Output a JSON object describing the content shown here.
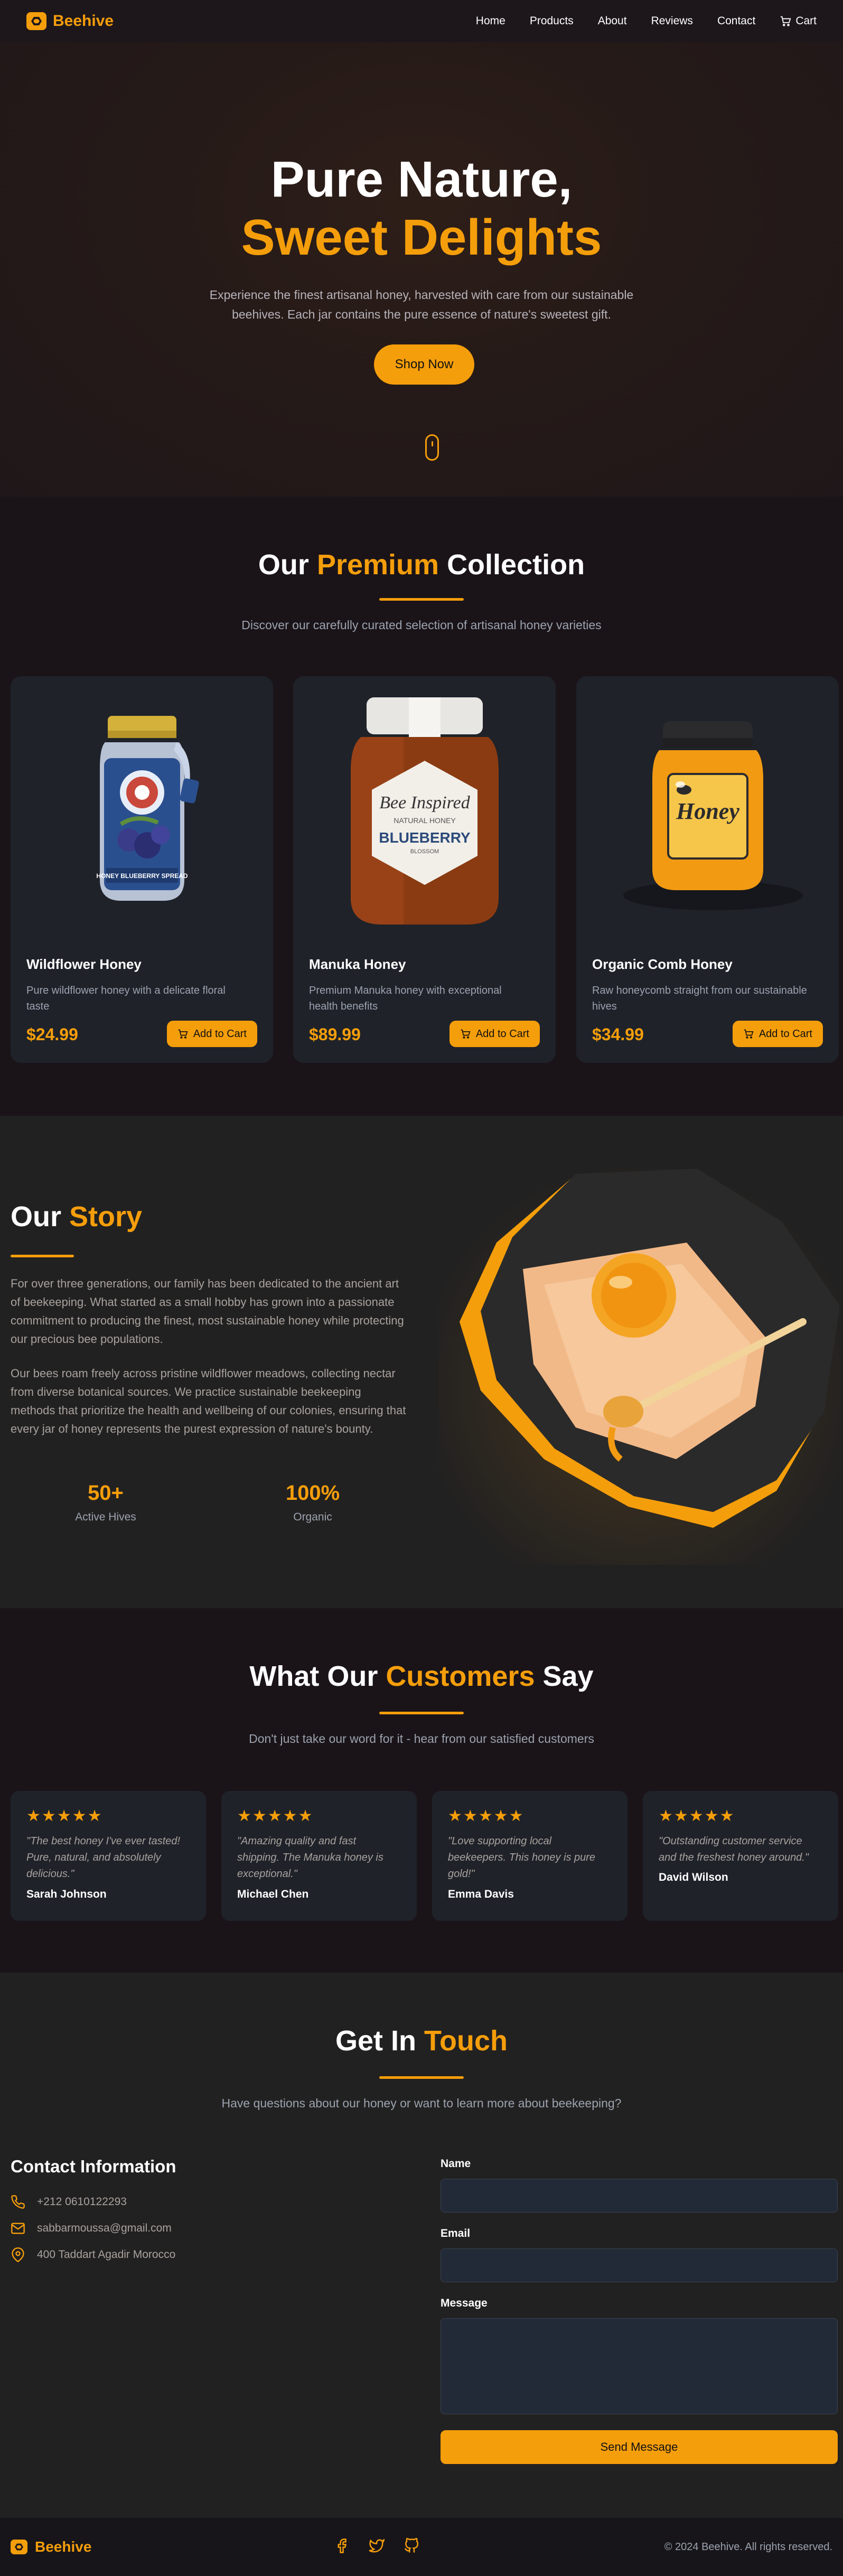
{
  "colors": {
    "accent": "#f59e0b",
    "background": "#1a1419",
    "card": "#1f2229",
    "section_alt": "#222121"
  },
  "nav": {
    "brand": "Beehive",
    "links": [
      "Home",
      "Products",
      "About",
      "Reviews",
      "Contact"
    ],
    "cart": "Cart"
  },
  "hero": {
    "title_line1": "Pure Nature,",
    "title_line2": "Sweet Delights",
    "subtitle": "Experience the finest artisanal honey, harvested with care from our sustainable beehives. Each jar contains the pure essence of nature's sweetest gift.",
    "cta": "Shop Now"
  },
  "products": {
    "title_pre": "Our",
    "title_accent": "Premium",
    "title_post": "Collection",
    "subtitle": "Discover our carefully curated selection of artisanal honey varieties",
    "add_label": "Add to Cart",
    "items": [
      {
        "name": "Wildflower Honey",
        "desc": "Pure wildflower honey with a delicate floral taste",
        "price": "$24.99",
        "jar_label": "HONEY BLUEBERRY SPREAD"
      },
      {
        "name": "Manuka Honey",
        "desc": "Premium Manuka honey with exceptional health benefits",
        "price": "$89.99",
        "jar_label_1": "Bee Inspired",
        "jar_label_2": "NATURAL HONEY",
        "jar_label_3": "BLUEBERRY",
        "jar_label_4": "BLOSSOM"
      },
      {
        "name": "Organic Comb Honey",
        "desc": "Raw honeycomb straight from our sustainable hives",
        "price": "$34.99",
        "jar_label": "Honey"
      }
    ]
  },
  "story": {
    "title_pre": "Our",
    "title_accent": "Story",
    "p1": "For over three generations, our family has been dedicated to the ancient art of beekeeping. What started as a small hobby has grown into a passionate commitment to producing the finest, most sustainable honey while protecting our precious bee populations.",
    "p2": "Our bees roam freely across pristine wildflower meadows, collecting nectar from diverse botanical sources. We practice sustainable beekeeping methods that prioritize the health and wellbeing of our colonies, ensuring that every jar of honey represents the purest expression of nature's bounty.",
    "stats": [
      {
        "value": "50+",
        "label": "Active Hives"
      },
      {
        "value": "100%",
        "label": "Organic"
      }
    ]
  },
  "reviews": {
    "title_pre": "What Our",
    "title_accent": "Customers",
    "title_post": "Say",
    "subtitle": "Don't just take our word for it - hear from our satisfied customers",
    "stars": "★★★★★",
    "items": [
      {
        "text": "\"The best honey I've ever tasted! Pure, natural, and absolutely delicious.\"",
        "name": "Sarah Johnson",
        "rating": 5
      },
      {
        "text": "\"Amazing quality and fast shipping. The Manuka honey is exceptional.\"",
        "name": "Michael Chen",
        "rating": 5
      },
      {
        "text": "\"Love supporting local beekeepers. This honey is pure gold!\"",
        "name": "Emma Davis",
        "rating": 5
      },
      {
        "text": "\"Outstanding customer service and the freshest honey around.\"",
        "name": "David Wilson",
        "rating": 5
      }
    ]
  },
  "contact": {
    "title_pre": "Get In",
    "title_accent": "Touch",
    "subtitle": "Have questions about our honey or want to learn more about beekeeping?",
    "info_title": "Contact Information",
    "phone": "+212 0610122293",
    "email": "sabbarmoussa@gmail.com",
    "address": "400 Taddart Agadir Morocco",
    "form": {
      "name_label": "Name",
      "email_label": "Email",
      "message_label": "Message",
      "name_value": "",
      "email_value": "",
      "message_value": "",
      "submit": "Send Message"
    }
  },
  "footer": {
    "brand": "Beehive",
    "socials": [
      "facebook-icon",
      "twitter-icon",
      "github-icon"
    ],
    "copyright": "© 2024 Beehive. All rights reserved."
  }
}
